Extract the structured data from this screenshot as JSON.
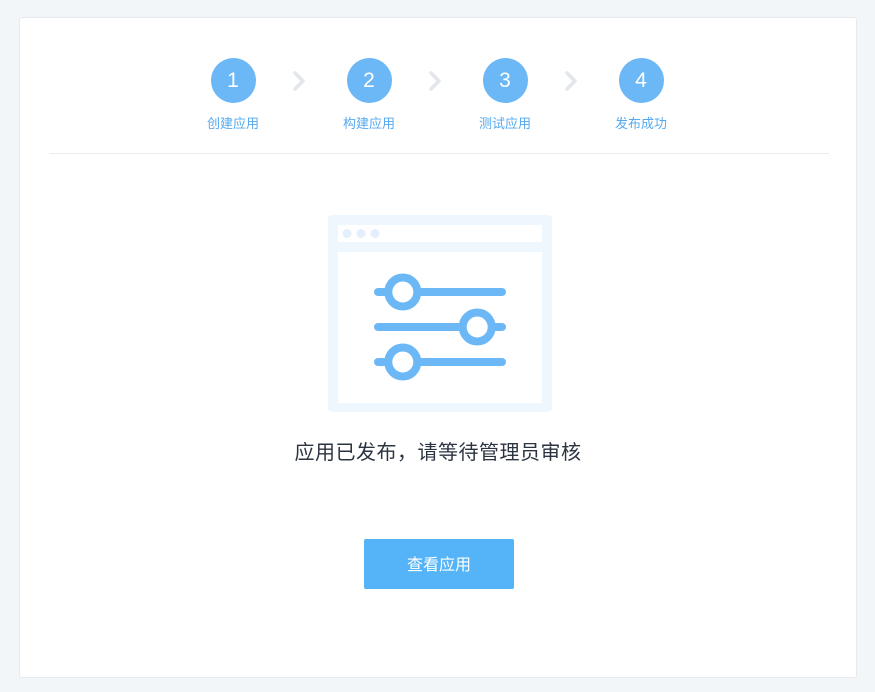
{
  "steps": [
    {
      "number": "1",
      "label": "创建应用"
    },
    {
      "number": "2",
      "label": "构建应用"
    },
    {
      "number": "3",
      "label": "测试应用"
    },
    {
      "number": "4",
      "label": "发布成功"
    }
  ],
  "illustration": {
    "icon": "settings-sliders-window-icon",
    "slider_levels": [
      0.2,
      0.8,
      0.2
    ]
  },
  "message": "应用已发布，请等待管理员审核",
  "view_button_label": "查看应用",
  "colors": {
    "accent": "#6cb8f7",
    "button": "#55b4f7",
    "step_label": "#56a9ef",
    "arrow": "#e3e6ea",
    "illustration_bg": "#eef6fe"
  }
}
